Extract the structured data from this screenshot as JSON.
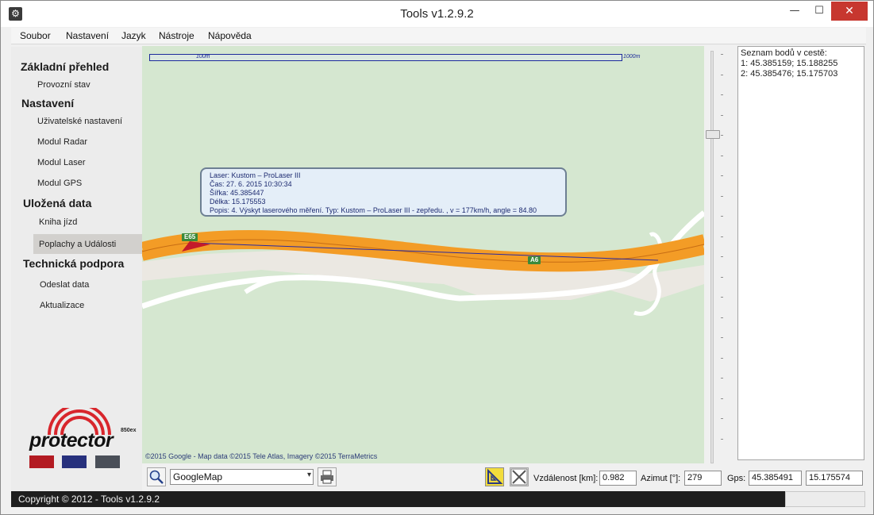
{
  "window": {
    "title": "Tools v1.2.9.2",
    "app_icon": "gear-icon",
    "minimize": "—",
    "maximize": "☐",
    "close": "✕"
  },
  "menu": [
    "Soubor",
    "Nastavení",
    "Jazyk",
    "Nástroje",
    "Nápověda"
  ],
  "sidebar": {
    "sections": [
      {
        "heading": "Základní přehled",
        "items": [
          "Provozní stav"
        ]
      },
      {
        "heading": "Nastavení",
        "items": [
          "Uživatelské nastavení",
          "Modul Radar",
          "Modul Laser",
          "Modul GPS"
        ]
      },
      {
        "heading": "Uložená data",
        "items": [
          "Kniha jízd",
          "Poplachy a Události"
        ]
      },
      {
        "heading": "Technická podpora",
        "items": [
          "Odeslat data",
          "Aktualizace"
        ]
      }
    ],
    "selected_item": "Poplachy a Události",
    "logo": {
      "word": "protector",
      "model": "850ex",
      "colors": {
        "arc": "#d8262c",
        "red": "#b31b22",
        "blue": "#27317d",
        "gray": "#4a4f58"
      }
    }
  },
  "map": {
    "scale_small": "100m",
    "scale_large": "1000m",
    "copyright": "©2015 Google - Map data ©2015 Tele Atlas, Imagery ©2015 TerraMetrics",
    "road_labels": [
      "E65",
      "A6"
    ],
    "colors": {
      "land": "#d5e7d0",
      "motorway": "#f39c26",
      "urban": "#ebe8e2",
      "route": "#2a2aa0",
      "marker": "#c41a2a"
    },
    "tooltip": {
      "lines": [
        "Laser:  Kustom – ProLaser III",
        "Čas: 27. 6. 2015 10:30:34",
        "Šířka: 45.385447",
        "Délka: 15.175553",
        "Popis: 4.  Výskyt laserového měření. Typ: Kustom – ProLaser III - zepředu. , v = 177km/h, angle = 84.80"
      ]
    }
  },
  "route_panel": {
    "title": "Seznam bodů v cestě:",
    "points": [
      "1: 45.385159; 15.188255",
      "2: 45.385476; 15.175703"
    ]
  },
  "toolbar": {
    "zoom_icon": "magnifier-icon",
    "map_type": "GoogleMap",
    "print_icon": "printer-icon",
    "ruler_icon": "ruler-triangle-icon",
    "clear_icon": "clear-x-icon",
    "distance_label": "Vzdálenost [km]:",
    "distance_value": "0.982",
    "azimuth_label": "Azimut [°]:",
    "azimuth_value": "279",
    "gps_label": "Gps:",
    "gps_lat": "45.385491",
    "gps_lon": "15.175574"
  },
  "status": {
    "copyright": "Copyright © 2012 - Tools v1.2.9.2"
  }
}
